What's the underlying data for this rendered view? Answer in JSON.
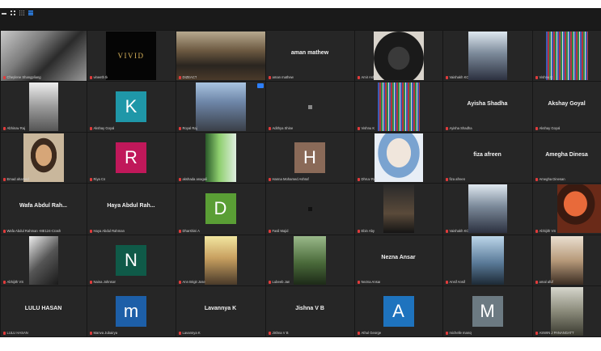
{
  "toolbar": {
    "view_icons": [
      "dash-icon",
      "grid-small-icon",
      "grid-medium-icon",
      "grid-large-icon"
    ]
  },
  "colors": {
    "grid_bg": "#161616",
    "tile_bg": "#262626",
    "speaking_border": "#c8e05a",
    "muted_mic": "#e03b3b",
    "badge": "#2d7ff9"
  },
  "participants": [
    {
      "name": "Cheylene Shangpliang",
      "kind": "video",
      "video": "selfie",
      "speaking": true
    },
    {
      "name": "vineeth tk",
      "kind": "video",
      "video": "vivid",
      "logo_text": "VIVID"
    },
    {
      "name": "DIZEACT",
      "kind": "video",
      "video": "room"
    },
    {
      "name": "aman mathew",
      "kind": "name",
      "display": "aman mathew"
    },
    {
      "name": "Amir Ashraf",
      "kind": "video",
      "video": "niqab"
    },
    {
      "name": "Vaishakh KC",
      "kind": "video",
      "video": "person"
    },
    {
      "name": "Vishnu K",
      "kind": "video",
      "video": "noise"
    },
    {
      "name": "Abhinav Raj",
      "kind": "video",
      "video": "room2"
    },
    {
      "name": "Akshay Goyal",
      "kind": "avatar",
      "letter": "K",
      "color": "#1f97a8"
    },
    {
      "name": "Royal Raj",
      "kind": "video",
      "video": "movie",
      "badge": true
    },
    {
      "name": "Adithya Shine",
      "kind": "dot",
      "dot": "grey"
    },
    {
      "name": "Vishnu K",
      "kind": "video",
      "video": "noise"
    },
    {
      "name": "Ayisha Shadha",
      "kind": "name",
      "display": "Ayisha Shadha"
    },
    {
      "name": "Akshay Goyal",
      "kind": "name",
      "display": "Akshay Goyal"
    },
    {
      "name": "Emad ahamed",
      "kind": "video",
      "video": "face"
    },
    {
      "name": "Riya Cs",
      "kind": "avatar",
      "letter": "R",
      "color": "#c0185a"
    },
    {
      "name": "akshada anagali",
      "kind": "video",
      "video": "green"
    },
    {
      "name": "Hanna Mohamed Ashraf",
      "kind": "avatar",
      "letter": "H",
      "color": "#8a6a58"
    },
    {
      "name": "Dhruv Raj",
      "kind": "video",
      "video": "anime"
    },
    {
      "name": "fiza afreen",
      "kind": "name",
      "display": "fiza afreen"
    },
    {
      "name": "Amegha Dinesan",
      "kind": "name",
      "display": "Amegha Dinesa"
    },
    {
      "name": "Wafa Abdul Rahman -ME124-Crash",
      "kind": "name",
      "display": "Wafa Abdul Rah..."
    },
    {
      "name": "Haya Abdul Rahman",
      "kind": "name",
      "display": "Haya Abdul Rah..."
    },
    {
      "name": "Dharshini A",
      "kind": "avatar",
      "letter": "D",
      "color": "#5a9e35"
    },
    {
      "name": "Fasil Majid",
      "kind": "dot",
      "dot": "dark"
    },
    {
      "name": "Ebin Aby",
      "kind": "video",
      "video": "dark"
    },
    {
      "name": "Vaishakh KC",
      "kind": "video",
      "video": "person"
    },
    {
      "name": "Abhijith VS",
      "kind": "video",
      "video": "red"
    },
    {
      "name": "Abhijith VS",
      "kind": "video",
      "video": "bw"
    },
    {
      "name": "Naina Johnson",
      "kind": "avatar",
      "letter": "N",
      "color": "#0f5a48"
    },
    {
      "name": "Ann Brigit Jose",
      "kind": "video",
      "video": "arch"
    },
    {
      "name": "Lubeeb Jan",
      "kind": "video",
      "video": "forest"
    },
    {
      "name": "Nezna Ansar",
      "kind": "name",
      "display": "Nezna Ansar"
    },
    {
      "name": "Ansif Ansif",
      "kind": "video",
      "video": "lake"
    },
    {
      "name": "amal afuf",
      "kind": "video",
      "video": "cafe"
    },
    {
      "name": "LULU HASAN",
      "kind": "name",
      "display": "LULU HASAN"
    },
    {
      "name": "Manva Jubairya",
      "kind": "avatar",
      "letter": "m",
      "color": "#1d5fa8"
    },
    {
      "name": "Lavannya K",
      "kind": "name",
      "display": "Lavannya K"
    },
    {
      "name": "Jishna V B",
      "kind": "name",
      "display": "Jishna V B"
    },
    {
      "name": "Athul George",
      "kind": "avatar",
      "letter": "A",
      "color": "#1e73be"
    },
    {
      "name": "michelle manoj",
      "kind": "avatar",
      "letter": "M",
      "color": "#6c7a82"
    },
    {
      "name": "ASWIN J PANANGATT",
      "kind": "video",
      "video": "street"
    }
  ]
}
